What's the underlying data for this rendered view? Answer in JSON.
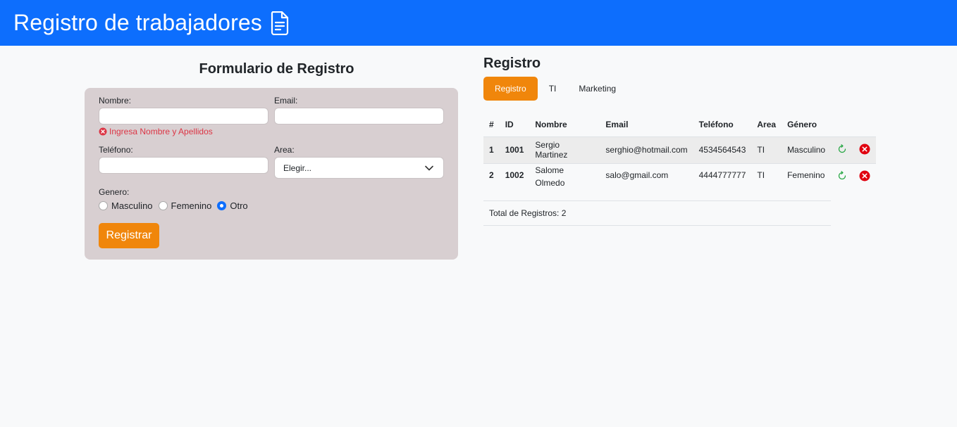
{
  "header": {
    "title": "Registro de trabajadores",
    "icon": "file-text-icon"
  },
  "form": {
    "title": "Formulario de Registro",
    "nombre_label": "Nombre:",
    "nombre_value": "",
    "nombre_error": "Ingresa Nombre y Apellidos",
    "email_label": "Email:",
    "email_value": "",
    "telefono_label": "Teléfono:",
    "telefono_value": "",
    "area_label": "Area:",
    "area_selected": "Elegir...",
    "genero_label": "Genero:",
    "genero_options": [
      "Masculino",
      "Femenino",
      "Otro"
    ],
    "genero_selected": "Otro",
    "submit_label": "Registrar"
  },
  "registro": {
    "title": "Registro",
    "tabs": [
      "Registro",
      "TI",
      "Marketing"
    ],
    "active_tab": "Registro",
    "columns": [
      "#",
      "ID",
      "Nombre",
      "Email",
      "Teléfono",
      "Area",
      "Género"
    ],
    "rows": [
      {
        "n": "1",
        "id": "1001",
        "nombre": "Sergio Martinez",
        "email": "serghio@hotmail.com",
        "telefono": "4534564543",
        "area": "TI",
        "genero": "Masculino"
      },
      {
        "n": "2",
        "id": "1002",
        "nombre": "Salome Olmedo",
        "email": "salo@gmail.com",
        "telefono": "4444777777",
        "area": "TI",
        "genero": "Femenino"
      }
    ],
    "total_label": "Total de Registros: 2"
  },
  "colors": {
    "navbar": "#0d6efd",
    "accent": "#f0860b",
    "card": "#d8cfd1",
    "error": "#dc3545",
    "refresh": "#28a745",
    "delete": "#e0000f"
  }
}
